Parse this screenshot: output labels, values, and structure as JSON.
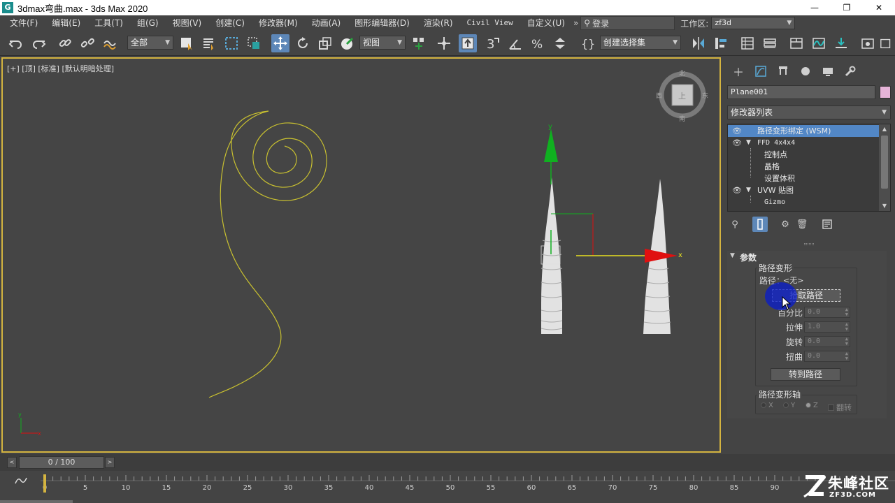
{
  "window": {
    "title": "3dmax弯曲.max - 3ds Max 2020",
    "app_icon": "G",
    "minimize": "—",
    "maximize": "❐",
    "close": "✕"
  },
  "menus": [
    "文件(F)",
    "编辑(E)",
    "工具(T)",
    "组(G)",
    "视图(V)",
    "创建(C)",
    "修改器(M)",
    "动画(A)",
    "图形编辑器(D)",
    "渲染(R)",
    "Civil View",
    "自定义(U)"
  ],
  "menu_overflow": "»",
  "login": {
    "label": "登录",
    "icon": "user-icon"
  },
  "workspace": {
    "label": "工作区:",
    "value": "zf3d"
  },
  "toolbar": {
    "selection_filter": "全部",
    "ref_coord": "视图",
    "named_selection": "创建选择集"
  },
  "viewport": {
    "label": "[+] [顶] [标准] [默认明暗处理]",
    "viewcube": {
      "face": "上",
      "north": "北",
      "south": "南",
      "east": "东",
      "west": "西"
    },
    "gizmo": {
      "x_label": "x",
      "y_label": "y"
    },
    "axis_tripod": {
      "x": "x",
      "y": "y"
    },
    "colors": {
      "border": "#d4b440",
      "spline": "#c8c030",
      "gizmo_x": "#e01010",
      "gizmo_y": "#10b020",
      "gizmo_plane": "#e8e020"
    }
  },
  "command_panel": {
    "object_name": "Plane001",
    "object_color": "#e6b4d8",
    "modifier_list": "修改器列表",
    "stack": [
      {
        "label": "路径变形绑定 (WSM)",
        "selected": true,
        "eye": true,
        "expandable": false
      },
      {
        "label": "FFD 4x4x4",
        "selected": false,
        "eye": true,
        "expandable": true
      },
      {
        "label": "控制点",
        "sub": true
      },
      {
        "label": "晶格",
        "sub": true
      },
      {
        "label": "设置体积",
        "sub": true
      },
      {
        "label": "UVW 贴图",
        "selected": false,
        "eye": true,
        "expandable": true
      },
      {
        "label": "Gizmo",
        "sub": true
      }
    ],
    "rollout_title": "参数",
    "group_path_deform": "路径变形",
    "path_label": "路径：",
    "path_value": "<无>",
    "pick_path": "拾取路径",
    "params": [
      {
        "label": "百分比",
        "value": "0.0"
      },
      {
        "label": "拉伸",
        "value": "1.0"
      },
      {
        "label": "旋转",
        "value": "0.0"
      },
      {
        "label": "扭曲",
        "value": "0.0"
      }
    ],
    "move_to_path": "转到路径",
    "group_axis": "路径变形轴",
    "axis_x": "X",
    "axis_y": "Y",
    "axis_z": "Z",
    "axis_selected": "Z",
    "flip": "翻转"
  },
  "time_slider": {
    "value": "0 / 100",
    "prev": "<",
    "next": ">"
  },
  "track_bar": {
    "ticks": [
      "0",
      "5",
      "10",
      "15",
      "20",
      "25",
      "30",
      "35",
      "40",
      "45",
      "50",
      "55",
      "60",
      "65",
      "70",
      "75",
      "80",
      "85",
      "90"
    ]
  },
  "watermark": {
    "name": "朱峰社区",
    "url": "ZF3D.COM"
  }
}
